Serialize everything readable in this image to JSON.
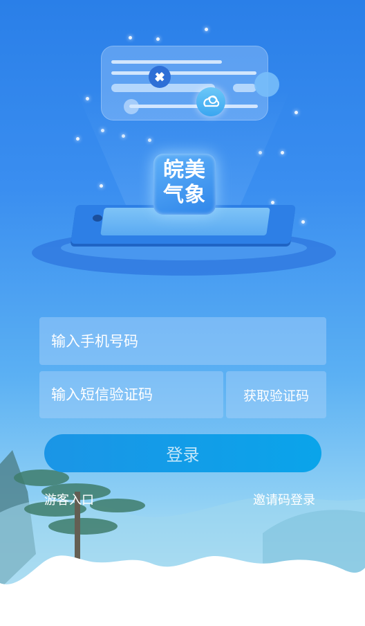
{
  "logo": {
    "line1": "皖美",
    "line2": "气象"
  },
  "form": {
    "phone_placeholder": "输入手机号码",
    "code_placeholder": "输入短信验证码",
    "get_code_label": "获取验证码",
    "login_label": "登录"
  },
  "links": {
    "guest_label": "游客入口",
    "invite_label": "邀请码登录"
  },
  "colors": {
    "bg_top": "#2a7fe8",
    "login_button": "#1b95e6",
    "accent": "#0aa4ea"
  },
  "icons": [
    "satellite-icon",
    "weather-cloud-sun-icon"
  ]
}
